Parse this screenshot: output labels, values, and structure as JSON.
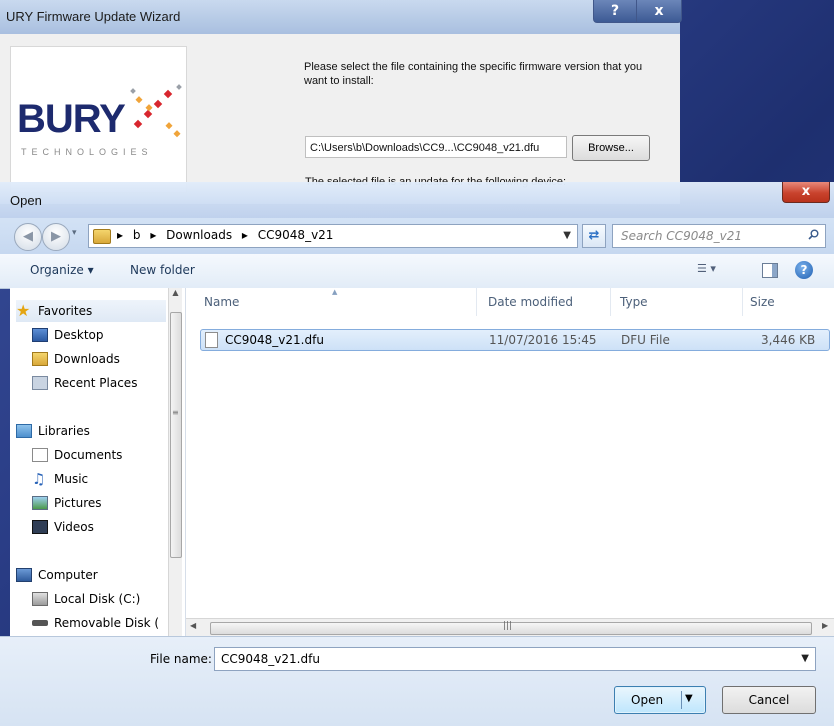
{
  "wizard": {
    "title": "URY Firmware Update Wizard",
    "help_label": "?",
    "close_label": "x",
    "logo_word": "BURY",
    "logo_tagline": "TECHNOLOGIES",
    "instruction": "Please select the file containing the specific firmware version that you want to install:",
    "file_path": "C:\\Users\\b\\Downloads\\CC9...\\CC9048_v21.dfu",
    "browse_label": "Browse...",
    "selected_info": "The selected file is an update for the following device:"
  },
  "dialog": {
    "title": "Open",
    "close_label": "x",
    "breadcrumb": [
      "b",
      "Downloads",
      "CC9048_v21"
    ],
    "search_placeholder": "Search CC9048_v21",
    "toolbar": {
      "organize_label": "Organize ▾",
      "new_folder_label": "New folder"
    },
    "nav": {
      "favorites": "Favorites",
      "favorites_items": [
        "Desktop",
        "Downloads",
        "Recent Places"
      ],
      "libraries": "Libraries",
      "libraries_items": [
        "Documents",
        "Music",
        "Pictures",
        "Videos"
      ],
      "computer": "Computer",
      "computer_items": [
        "Local Disk (C:)",
        "Removable Disk ("
      ]
    },
    "columns": {
      "name": "Name",
      "date_modified": "Date modified",
      "type": "Type",
      "size": "Size"
    },
    "files": [
      {
        "name": "CC9048_v21.dfu",
        "date_modified": "11/07/2016 15:45",
        "type": "DFU File",
        "size": "3,446 KB"
      }
    ],
    "file_name_label": "File name:",
    "file_name_value": "CC9048_v21.dfu",
    "open_label": "Open",
    "cancel_label": "Cancel"
  },
  "colors": {
    "desktop": "#2a3d86",
    "selection": "#cde1f7",
    "close_red": "#c9432d"
  }
}
